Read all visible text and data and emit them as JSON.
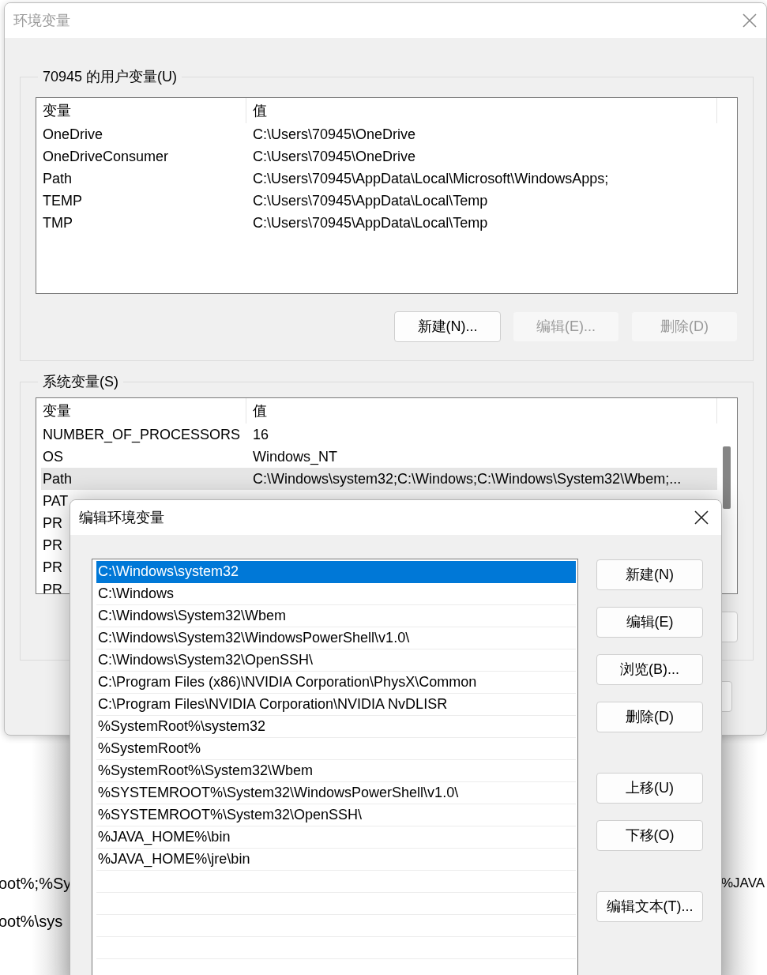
{
  "background_fragments": {
    "left": [
      "oot%;%Sy",
      "oot%\\sys"
    ],
    "right": [
      "%JAVA"
    ]
  },
  "env_window": {
    "title": "环境变量",
    "user_vars": {
      "legend": "70945 的用户变量(U)",
      "columns": [
        "变量",
        "值"
      ],
      "rows": [
        {
          "name": "OneDrive",
          "value": "C:\\Users\\70945\\OneDrive",
          "selected": false
        },
        {
          "name": "OneDriveConsumer",
          "value": "C:\\Users\\70945\\OneDrive",
          "selected": false
        },
        {
          "name": "Path",
          "value": "C:\\Users\\70945\\AppData\\Local\\Microsoft\\WindowsApps;",
          "selected": false
        },
        {
          "name": "TEMP",
          "value": "C:\\Users\\70945\\AppData\\Local\\Temp",
          "selected": false
        },
        {
          "name": "TMP",
          "value": "C:\\Users\\70945\\AppData\\Local\\Temp",
          "selected": false
        }
      ],
      "buttons": [
        {
          "label": "新建(N)...",
          "disabled": false
        },
        {
          "label": "编辑(E)...",
          "disabled": true
        },
        {
          "label": "删除(D)",
          "disabled": true
        }
      ]
    },
    "system_vars": {
      "legend": "系统变量(S)",
      "columns": [
        "变量",
        "值"
      ],
      "rows": [
        {
          "name": "NUMBER_OF_PROCESSORS",
          "value": "16",
          "selected": false
        },
        {
          "name": "OS",
          "value": "Windows_NT",
          "selected": false
        },
        {
          "name": "Path",
          "value": "C:\\Windows\\system32;C:\\Windows;C:\\Windows\\System32\\Wbem;...",
          "selected": true
        },
        {
          "name": "PAT",
          "selected": false
        },
        {
          "name": "PR",
          "selected": false
        },
        {
          "name": "PR",
          "selected": false
        },
        {
          "name": "PR",
          "selected": false
        },
        {
          "name": "PR",
          "selected": false
        }
      ]
    }
  },
  "edit_window": {
    "title": "编辑环境变量",
    "entries": [
      {
        "text": "C:\\Windows\\system32",
        "selected": true
      },
      {
        "text": "C:\\Windows",
        "selected": false
      },
      {
        "text": "C:\\Windows\\System32\\Wbem",
        "selected": false
      },
      {
        "text": "C:\\Windows\\System32\\WindowsPowerShell\\v1.0\\",
        "selected": false
      },
      {
        "text": "C:\\Windows\\System32\\OpenSSH\\",
        "selected": false
      },
      {
        "text": "C:\\Program Files (x86)\\NVIDIA Corporation\\PhysX\\Common",
        "selected": false
      },
      {
        "text": "C:\\Program Files\\NVIDIA Corporation\\NVIDIA NvDLISR",
        "selected": false
      },
      {
        "text": "%SystemRoot%\\system32",
        "selected": false
      },
      {
        "text": "%SystemRoot%",
        "selected": false
      },
      {
        "text": "%SystemRoot%\\System32\\Wbem",
        "selected": false
      },
      {
        "text": "%SYSTEMROOT%\\System32\\WindowsPowerShell\\v1.0\\",
        "selected": false
      },
      {
        "text": "%SYSTEMROOT%\\System32\\OpenSSH\\",
        "selected": false
      },
      {
        "text": "%JAVA_HOME%\\bin",
        "selected": false
      },
      {
        "text": "%JAVA_HOME%\\jre\\bin",
        "selected": false
      }
    ],
    "button_groups": [
      [
        {
          "label": "新建(N)"
        },
        {
          "label": "编辑(E)"
        },
        {
          "label": "浏览(B)..."
        },
        {
          "label": "删除(D)"
        }
      ],
      [
        {
          "label": "上移(U)"
        },
        {
          "label": "下移(O)"
        }
      ],
      [
        {
          "label": "编辑文本(T)..."
        }
      ]
    ]
  }
}
